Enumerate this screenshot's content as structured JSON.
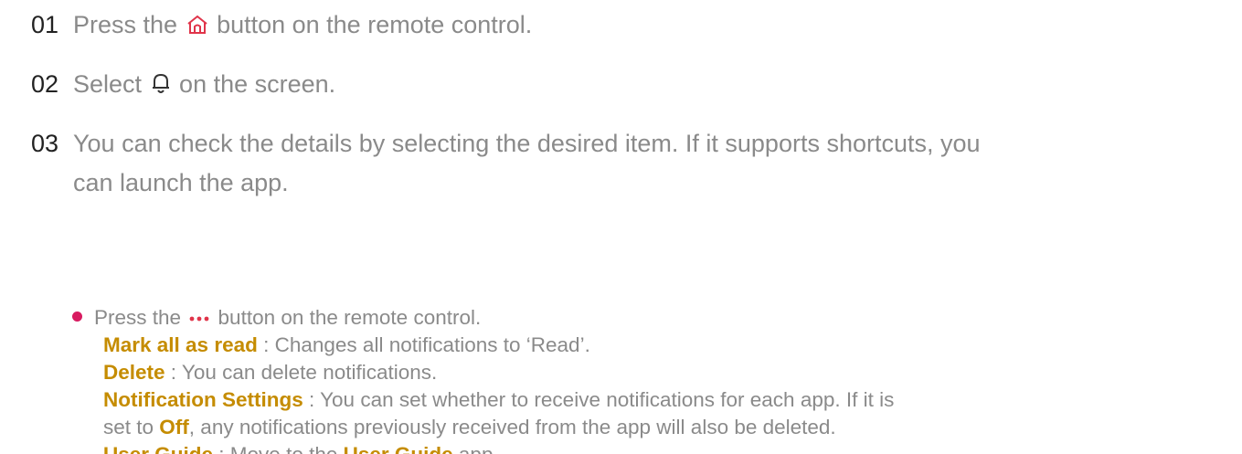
{
  "steps": [
    {
      "num": "01",
      "before": "Press the ",
      "icon": "home-icon",
      "after": " button on the remote control."
    },
    {
      "num": "02",
      "before": "Select ",
      "icon": "bell-icon",
      "after": " on the screen."
    },
    {
      "num": "03",
      "line1": "You can check the details by selecting the desired item. If it supports shortcuts, you",
      "line2": "can launch the app."
    }
  ],
  "bullet": {
    "before": "Press the ",
    "icon": "more-dots-icon",
    "after": " button on the remote control."
  },
  "options": [
    {
      "term": "Mark all as read",
      "desc": " : Changes all notifications to ‘Read’."
    },
    {
      "term": "Delete",
      "desc": " : You can delete notifications."
    },
    {
      "term": "Notification Settings",
      "desc": " : You can set whether to receive notifications for each app. If it is",
      "line2_before": "set to ",
      "line2_kw": "Off",
      "line2_after": ", any notifications previously received from the app will also be deleted."
    },
    {
      "term": "User Guide",
      "desc_before": " : Move to the ",
      "desc_kw": "User Guide",
      "desc_after": " app."
    }
  ],
  "colors": {
    "keyword": "#c58c00",
    "bullet": "#d81b60",
    "text": "#8a8a8a",
    "number": "#222222",
    "icon_red": "#e0344a"
  }
}
